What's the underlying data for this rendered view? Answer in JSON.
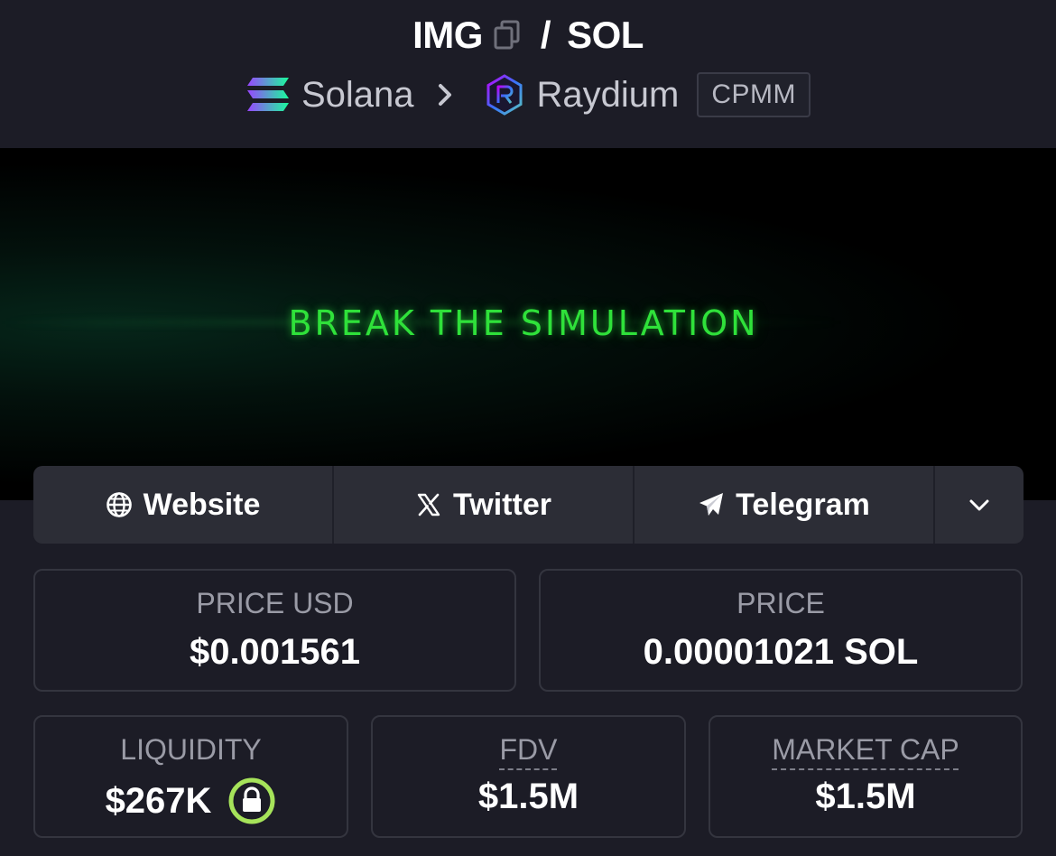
{
  "header": {
    "base_token": "IMG",
    "separator": "/",
    "quote_token": "SOL",
    "chain": "Solana",
    "dex": "Raydium",
    "pool_type": "CPMM"
  },
  "banner": {
    "text": "BREAK THE SIMULATION"
  },
  "links": {
    "website": "Website",
    "twitter": "Twitter",
    "telegram": "Telegram"
  },
  "stats": {
    "price_usd": {
      "label": "PRICE USD",
      "value": "$0.001561"
    },
    "price": {
      "label": "PRICE",
      "value": "0.00001021 SOL"
    },
    "liquidity": {
      "label": "LIQUIDITY",
      "value": "$267K"
    },
    "fdv": {
      "label": "FDV",
      "value": "$1.5M"
    },
    "market_cap": {
      "label": "MARKET CAP",
      "value": "$1.5M"
    }
  },
  "colors": {
    "background": "#1c1c26",
    "banner_text": "#2fe13a",
    "lock_accent": "#a6e35a"
  },
  "icons": {
    "copy": "copy-icon",
    "chain": "solana-icon",
    "dex": "raydium-icon",
    "website": "globe-icon",
    "twitter": "x-icon",
    "telegram": "telegram-icon",
    "more": "chevron-down-icon",
    "liquidity_lock": "lock-icon"
  }
}
